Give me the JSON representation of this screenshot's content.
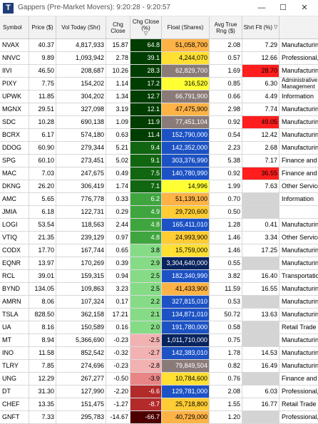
{
  "window": {
    "title": "Gappers (Pre-Market Movers):  9:20:28 - 9:20:57",
    "logo_letter": "T",
    "minimize_glyph": "—",
    "maximize_glyph": "☐",
    "close_glyph": "✕"
  },
  "columns": [
    "Symbol",
    "Price ($)",
    "Vol Today (Shr)",
    "Chg Close",
    "Chg Close (%)",
    "Float (Shares)",
    "Avg True Rng ($)",
    "Shrt Flt (%)",
    ""
  ],
  "sort_indicator": "▽",
  "rows": [
    {
      "symbol": "NVAX",
      "price": "40.37",
      "volume": "4,817,933",
      "chg": "15.87",
      "chg_pct": "64.8",
      "float": "51,058,700",
      "atr": "2.08",
      "short": "7.29",
      "industry": "Manufacturing"
    },
    {
      "symbol": "NNVC",
      "price": "9.89",
      "volume": "1,093,942",
      "chg": "2.78",
      "chg_pct": "39.1",
      "float": "4,244,070",
      "atr": "0.57",
      "short": "12.66",
      "industry": "Professional, S"
    },
    {
      "symbol": "IIVI",
      "price": "46.50",
      "volume": "208,687",
      "chg": "10.26",
      "chg_pct": "28.3",
      "float": "62,829,700",
      "atr": "1.69",
      "short": "28.70",
      "industry": "Manufacturing"
    },
    {
      "symbol": "PIXY",
      "price": "7.75",
      "volume": "154,202",
      "chg": "1.14",
      "chg_pct": "17.2",
      "float": "316,520",
      "atr": "0.85",
      "short": "6.30",
      "industry": "Administrative Management a"
    },
    {
      "symbol": "UPWK",
      "price": "11.85",
      "volume": "304,202",
      "chg": "1.34",
      "chg_pct": "12.7",
      "float": "66,791,900",
      "atr": "0.66",
      "short": "4.49",
      "industry": "Information"
    },
    {
      "symbol": "MGNX",
      "price": "29.51",
      "volume": "327,098",
      "chg": "3.19",
      "chg_pct": "12.1",
      "float": "47,475,900",
      "atr": "2.98",
      "short": "7.74",
      "industry": "Manufacturing"
    },
    {
      "symbol": "SDC",
      "price": "10.28",
      "volume": "690,138",
      "chg": "1.09",
      "chg_pct": "11.9",
      "float": "77,451,104",
      "atr": "0.92",
      "short": "49.05",
      "industry": "Manufacturing"
    },
    {
      "symbol": "BCRX",
      "price": "6.17",
      "volume": "574,180",
      "chg": "0.63",
      "chg_pct": "11.4",
      "float": "152,790,000",
      "atr": "0.54",
      "short": "12.42",
      "industry": "Manufacturing"
    },
    {
      "symbol": "DDOG",
      "price": "60.90",
      "volume": "279,344",
      "chg": "5.21",
      "chg_pct": "9.4",
      "float": "142,352,000",
      "atr": "2.23",
      "short": "2.68",
      "industry": "Manufacturing"
    },
    {
      "symbol": "SPG",
      "price": "60.10",
      "volume": "273,451",
      "chg": "5.02",
      "chg_pct": "9.1",
      "float": "303,376,990",
      "atr": "5.38",
      "short": "7.17",
      "industry": "Finance and I"
    },
    {
      "symbol": "MAC",
      "price": "7.03",
      "volume": "247,675",
      "chg": "0.49",
      "chg_pct": "7.5",
      "float": "140,780,990",
      "atr": "0.92",
      "short": "36.55",
      "industry": "Finance and I"
    },
    {
      "symbol": "DKNG",
      "price": "26.20",
      "volume": "306,419",
      "chg": "1.74",
      "chg_pct": "7.1",
      "float": "14,996",
      "atr": "1.99",
      "short": "7.63",
      "industry": "Other Services"
    },
    {
      "symbol": "AMC",
      "price": "5.65",
      "volume": "776,778",
      "chg": "0.33",
      "chg_pct": "6.2",
      "float": "51,139,100",
      "atr": "0.70",
      "short": "",
      "industry": "Information"
    },
    {
      "symbol": "JMIA",
      "price": "6.18",
      "volume": "122,731",
      "chg": "0.29",
      "chg_pct": "4.9",
      "float": "29,720,600",
      "atr": "0.50",
      "short": "",
      "industry": ""
    },
    {
      "symbol": "LOGI",
      "price": "53.54",
      "volume": "118,563",
      "chg": "2.44",
      "chg_pct": "4.8",
      "float": "165,411,010",
      "atr": "1.28",
      "short": "0.41",
      "industry": "Manufacturing"
    },
    {
      "symbol": "VTIQ",
      "price": "21.35",
      "volume": "239,129",
      "chg": "0.97",
      "chg_pct": "4.8",
      "float": "24,993,900",
      "atr": "1.46",
      "short": "3.34",
      "industry": "Other Services"
    },
    {
      "symbol": "CODX",
      "price": "17.70",
      "volume": "167,744",
      "chg": "0.65",
      "chg_pct": "3.8",
      "float": "15,759,000",
      "atr": "1.46",
      "short": "17.25",
      "industry": "Manufacturing"
    },
    {
      "symbol": "EQNR",
      "price": "13.97",
      "volume": "170,269",
      "chg": "0.39",
      "chg_pct": "2.9",
      "float": "3,304,640,000",
      "atr": "0.55",
      "short": "",
      "industry": "Manufacturing"
    },
    {
      "symbol": "RCL",
      "price": "39.01",
      "volume": "159,315",
      "chg": "0.94",
      "chg_pct": "2.5",
      "float": "182,340,990",
      "atr": "3.82",
      "short": "16.40",
      "industry": "Transportation"
    },
    {
      "symbol": "BYND",
      "price": "134.05",
      "volume": "109,863",
      "chg": "3.23",
      "chg_pct": "2.5",
      "float": "41,433,900",
      "atr": "11.59",
      "short": "16.55",
      "industry": "Manufacturing"
    },
    {
      "symbol": "AMRN",
      "price": "8.06",
      "volume": "107,324",
      "chg": "0.17",
      "chg_pct": "2.2",
      "float": "327,815,010",
      "atr": "0.53",
      "short": "",
      "industry": "Manufacturing"
    },
    {
      "symbol": "TSLA",
      "price": "828.50",
      "volume": "362,158",
      "chg": "17.21",
      "chg_pct": "2.1",
      "float": "134,871,010",
      "atr": "50.72",
      "short": "13.63",
      "industry": "Manufacturing"
    },
    {
      "symbol": "UA",
      "price": "8.16",
      "volume": "150,589",
      "chg": "0.16",
      "chg_pct": "2.0",
      "float": "191,780,000",
      "atr": "0.58",
      "short": "",
      "industry": "Retail Trade"
    },
    {
      "symbol": "MT",
      "price": "8.94",
      "volume": "5,366,690",
      "chg": "-0.23",
      "chg_pct": "-2.5",
      "float": "1,011,710,000",
      "atr": "0.75",
      "short": "",
      "industry": "Manufacturing"
    },
    {
      "symbol": "INO",
      "price": "11.58",
      "volume": "852,542",
      "chg": "-0.32",
      "chg_pct": "-2.7",
      "float": "142,383,010",
      "atr": "1.78",
      "short": "14.53",
      "industry": "Manufacturing"
    },
    {
      "symbol": "TLRY",
      "price": "7.85",
      "volume": "274,696",
      "chg": "-0.23",
      "chg_pct": "-2.8",
      "float": "79,849,504",
      "atr": "0.82",
      "short": "16.49",
      "industry": "Manufacturing"
    },
    {
      "symbol": "UNG",
      "price": "12.29",
      "volume": "267,277",
      "chg": "-0.50",
      "chg_pct": "-3.9",
      "float": "10,784,600",
      "atr": "0.76",
      "short": "",
      "industry": "Finance and I"
    },
    {
      "symbol": "DT",
      "price": "31.30",
      "volume": "127,990",
      "chg": "-2.20",
      "chg_pct": "-6.6",
      "float": "129,781,000",
      "atr": "2.08",
      "short": "6.03",
      "industry": "Professional, S"
    },
    {
      "symbol": "CHEF",
      "price": "13.35",
      "volume": "151,475",
      "chg": "-1.27",
      "chg_pct": "-8.7",
      "float": "25,718,800",
      "atr": "1.55",
      "short": "16.77",
      "industry": "Retail Trade"
    },
    {
      "symbol": "GNFT",
      "price": "7.33",
      "volume": "295,783",
      "chg": "-14.67",
      "chg_pct": "-66.7",
      "float": "40,729,000",
      "atr": "1.20",
      "short": "",
      "industry": "Professional, S"
    }
  ],
  "colors": {
    "header_bg": "#f2f2f2",
    "grid": "#d8d8d8",
    "short_high": "#ff1e1e",
    "short_empty": "#d4d4d4",
    "float_small_yellow": "#ffff33",
    "float_orange": "#ffb347",
    "float_gray": "#8a7b78",
    "float_blue": "#1c52c4",
    "float_navy": "#08245e"
  }
}
